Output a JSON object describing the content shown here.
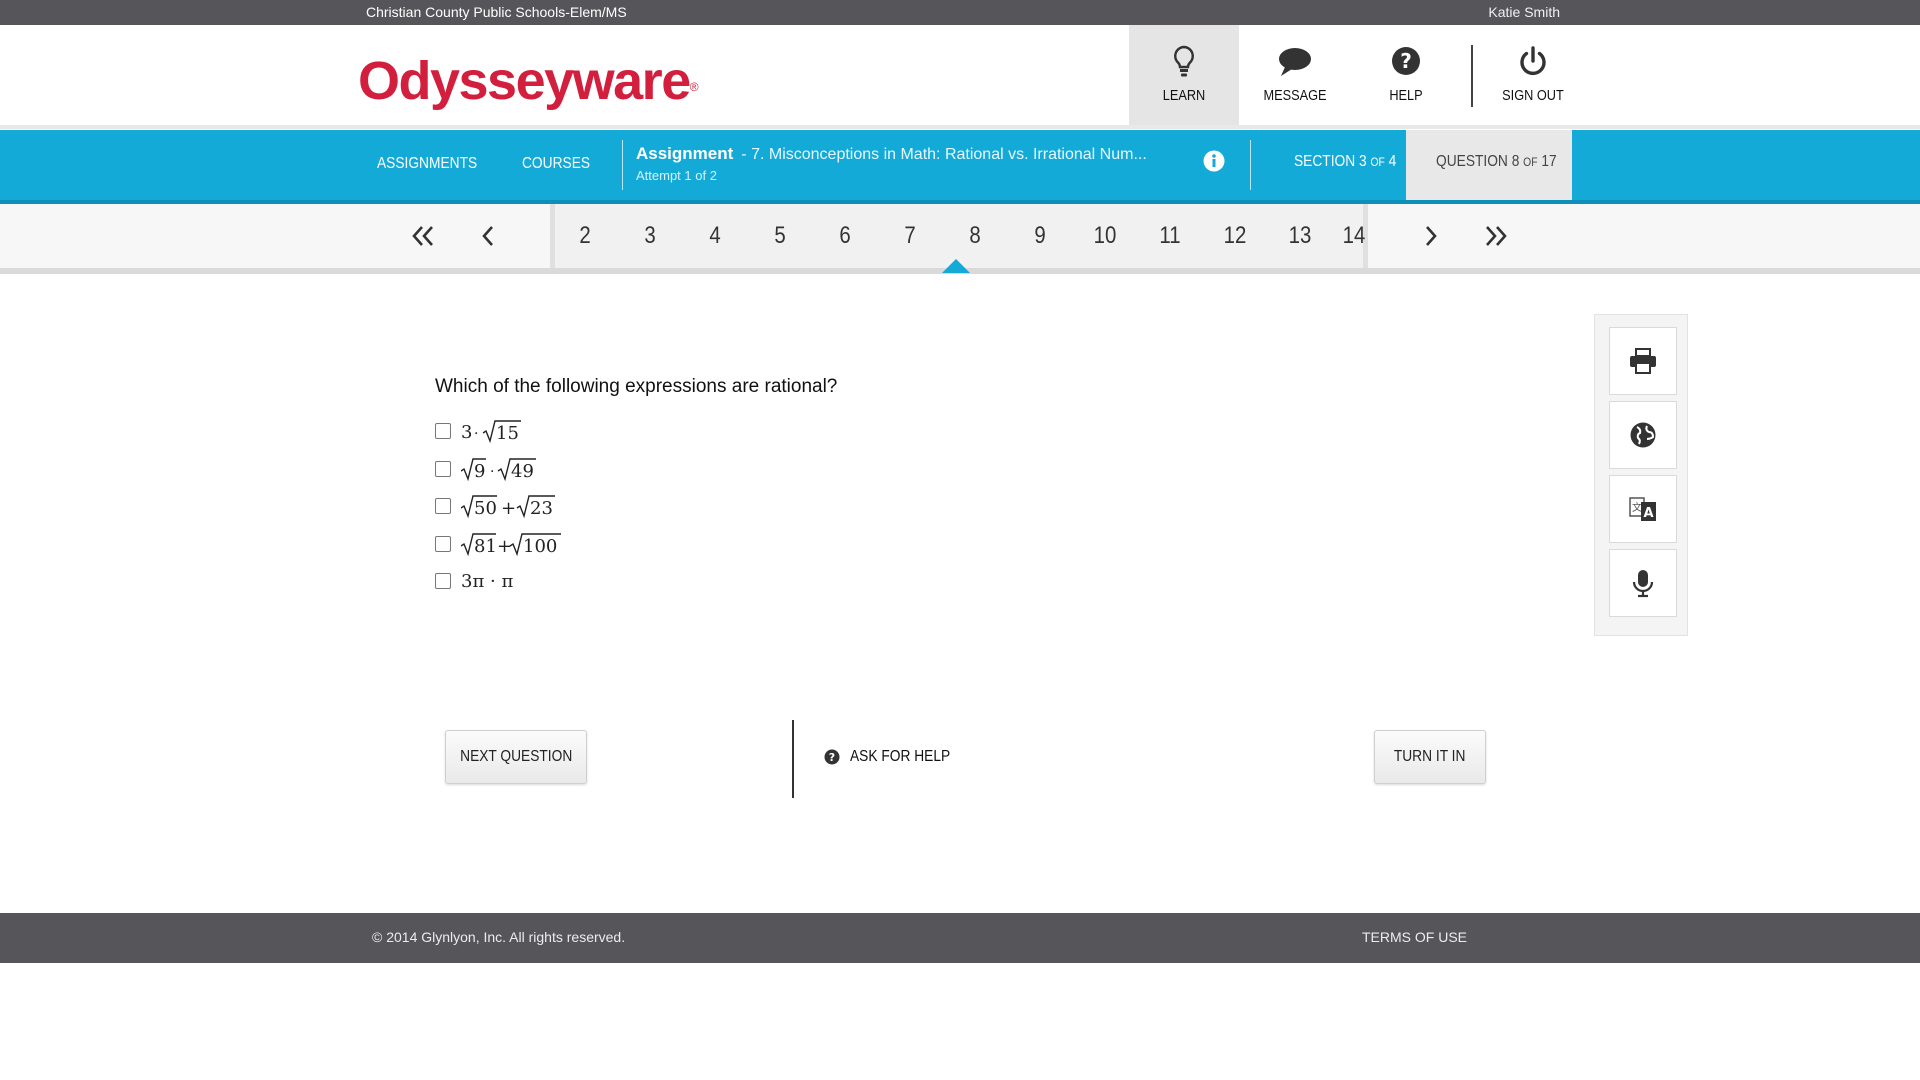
{
  "topbar": {
    "school": "Christian County Public Schools-Elem/MS",
    "user": "Katie Smith"
  },
  "header": {
    "logo": "Odysseyware",
    "logo_mark": "®",
    "nav": [
      {
        "label": "LEARN",
        "icon": "lightbulb-icon",
        "active": true
      },
      {
        "label": "MESSAGE",
        "icon": "chat-bubble-icon"
      },
      {
        "label": "HELP",
        "icon": "question-circle-icon"
      },
      {
        "label": "SIGN OUT",
        "icon": "power-icon"
      }
    ]
  },
  "bluebar": {
    "assignments": "ASSIGNMENTS",
    "courses": "COURSES",
    "assignment_label": "Assignment",
    "assignment_title": "- 7. Misconceptions in Math: Rational vs. Irrational Num...",
    "attempt": "Attempt 1 of 2",
    "section_word": "SECTION",
    "section_current": "3",
    "section_of": "OF",
    "section_total": "4",
    "question_word": "QUESTION",
    "question_current": "8",
    "question_of": "OF",
    "question_total": "17"
  },
  "pagination": {
    "pages": [
      "2",
      "3",
      "4",
      "5",
      "6",
      "7",
      "8",
      "9",
      "10",
      "11",
      "12",
      "13",
      "14"
    ],
    "current": "8"
  },
  "question": {
    "prompt": "Which of the following expressions are rational?",
    "options": [
      {
        "a": "3",
        "op": "·",
        "b": "",
        "r1": "",
        "r2": "15"
      },
      {
        "a": "",
        "op": "·",
        "r1": "9",
        "r2": "49"
      },
      {
        "a": "",
        "op": "+",
        "r1": "50",
        "r2": "23"
      },
      {
        "a": "",
        "op": "+",
        "r1": "81",
        "r2": "100"
      },
      {
        "text": "3π · π"
      }
    ]
  },
  "tools": [
    "printer-icon",
    "globe-icon",
    "translate-icon",
    "microphone-icon"
  ],
  "buttons": {
    "next": "NEXT QUESTION",
    "ask_help": "ASK FOR HELP",
    "turn_in": "TURN IT IN"
  },
  "footer": {
    "copyright": "© 2014 Glynlyon, Inc. All rights reserved.",
    "terms": "TERMS OF USE"
  },
  "colors": {
    "brand_red": "#d31f3e",
    "accent_blue": "#14aad8",
    "dark_gray": "#56565a"
  }
}
